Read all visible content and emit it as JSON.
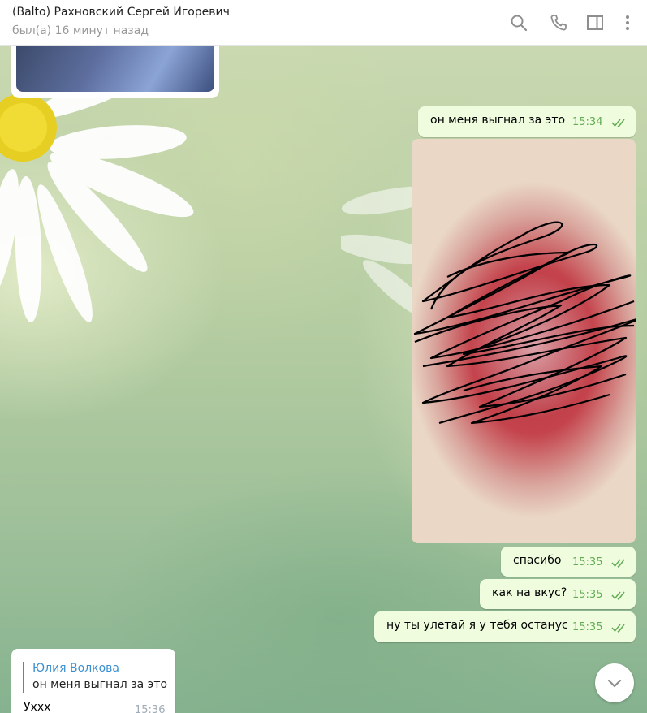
{
  "header": {
    "title": "(Balto) Рахновский Сергей Игоревич",
    "status": "был(а) 16 минут назад",
    "icons": [
      "search-icon",
      "phone-icon",
      "sidebar-icon",
      "more-icon"
    ]
  },
  "messages": [
    {
      "text": "он меня выгнал за это",
      "time": "15:34"
    },
    {
      "text": "спасибо",
      "time": "15:35"
    },
    {
      "text": "как на вкус?",
      "time": "15:35"
    },
    {
      "text": "ну ты улетай я у тебя останусь",
      "time": "15:35"
    }
  ],
  "incoming": {
    "reply_name": "Юлия Волкова",
    "reply_text": "он меня выгнал за это",
    "text": "Уххх",
    "time": "15:36"
  },
  "colors": {
    "outgoing_bubble": "#effdde",
    "time_green": "#62ac55",
    "link_blue": "#3a8fd0"
  }
}
